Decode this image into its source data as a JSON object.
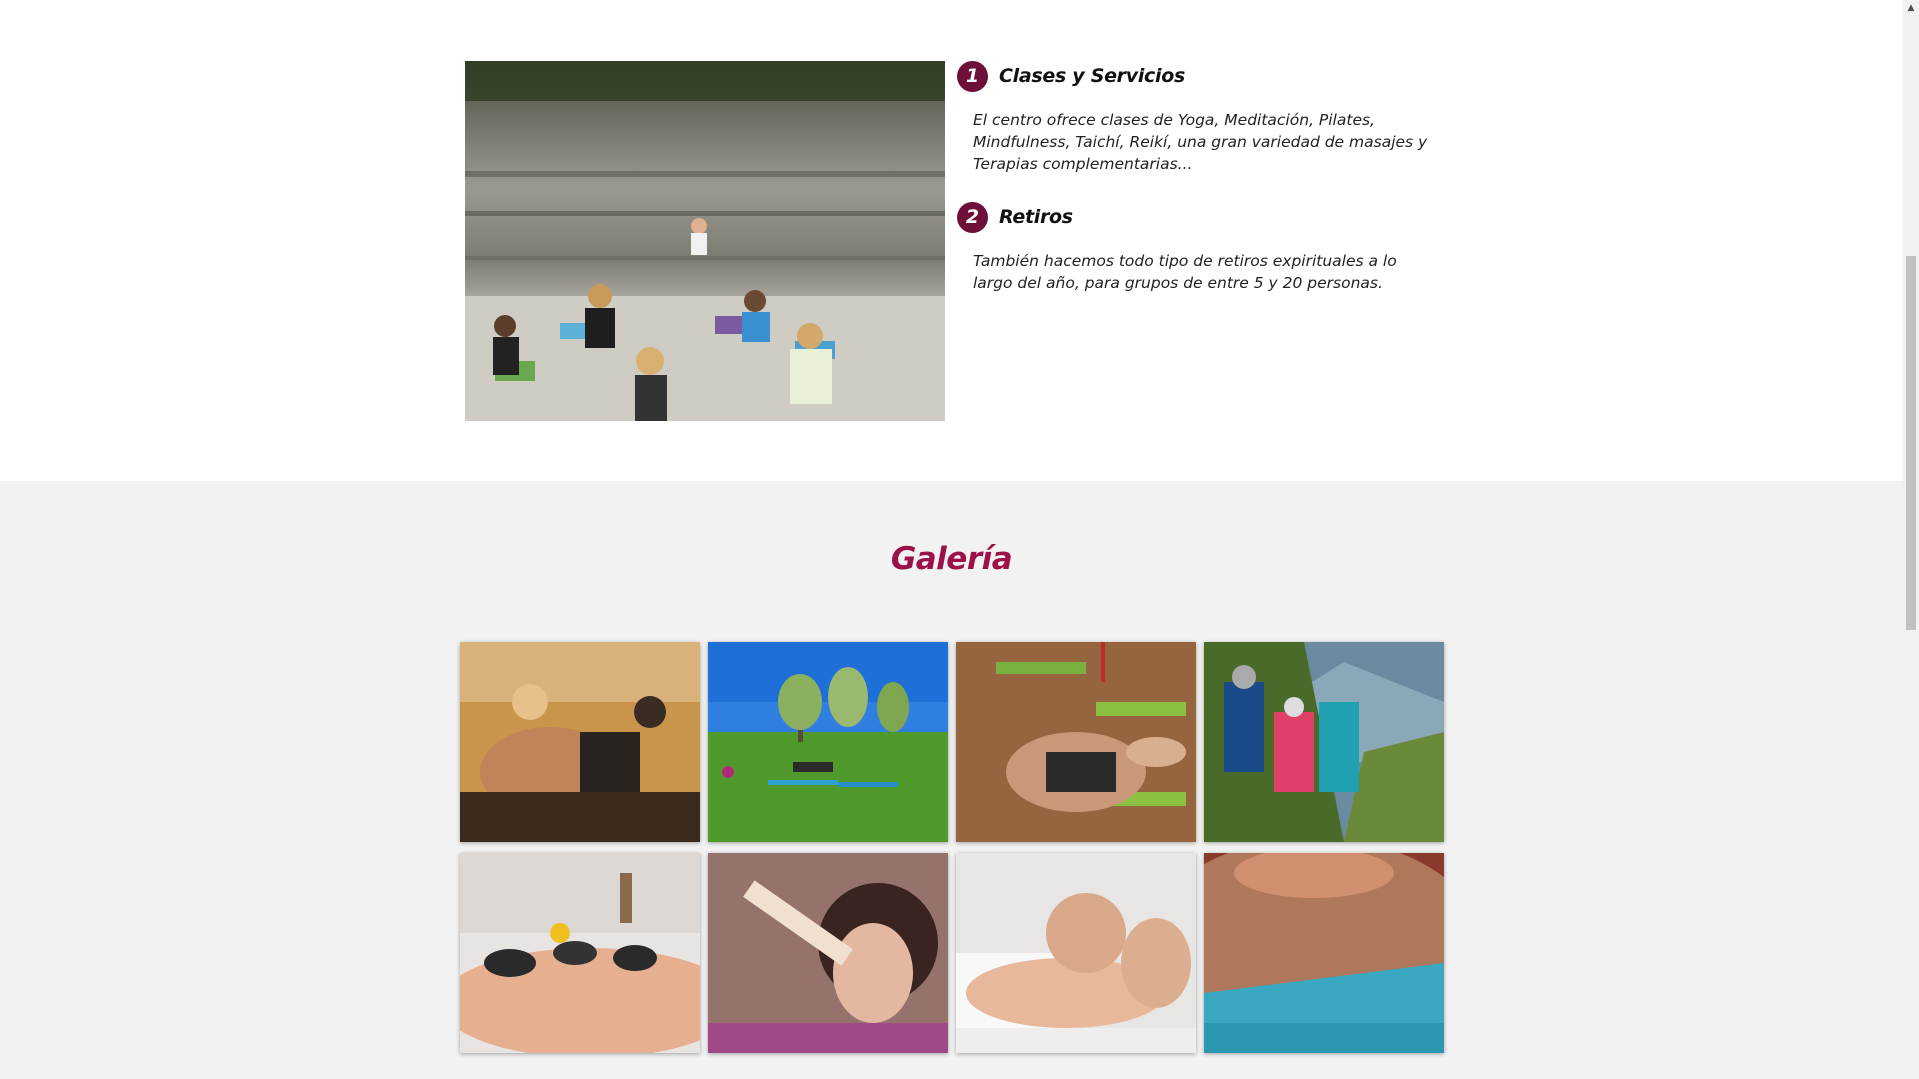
{
  "services": [
    {
      "number": "1",
      "title": "Clases y Servicios",
      "text": "El centro ofrece clases de Yoga, Meditación, Pilates, Mindfulness, Taichí, Reikí, una gran variedad de masajes y Terapias complementarias..."
    },
    {
      "number": "2",
      "title": "Retiros",
      "text": "También hacemos todo tipo de retiros expirituales a lo largo del año, para grupos de entre 5 y 20 personas."
    }
  ],
  "gallery": {
    "title": "Galería"
  },
  "colors": {
    "accent_dark": "#6e0f3a",
    "accent_title": "#9b1148",
    "gallery_bg": "#f2f2f2"
  },
  "icons": {
    "scroll_up": "scroll-up-arrow-icon"
  }
}
